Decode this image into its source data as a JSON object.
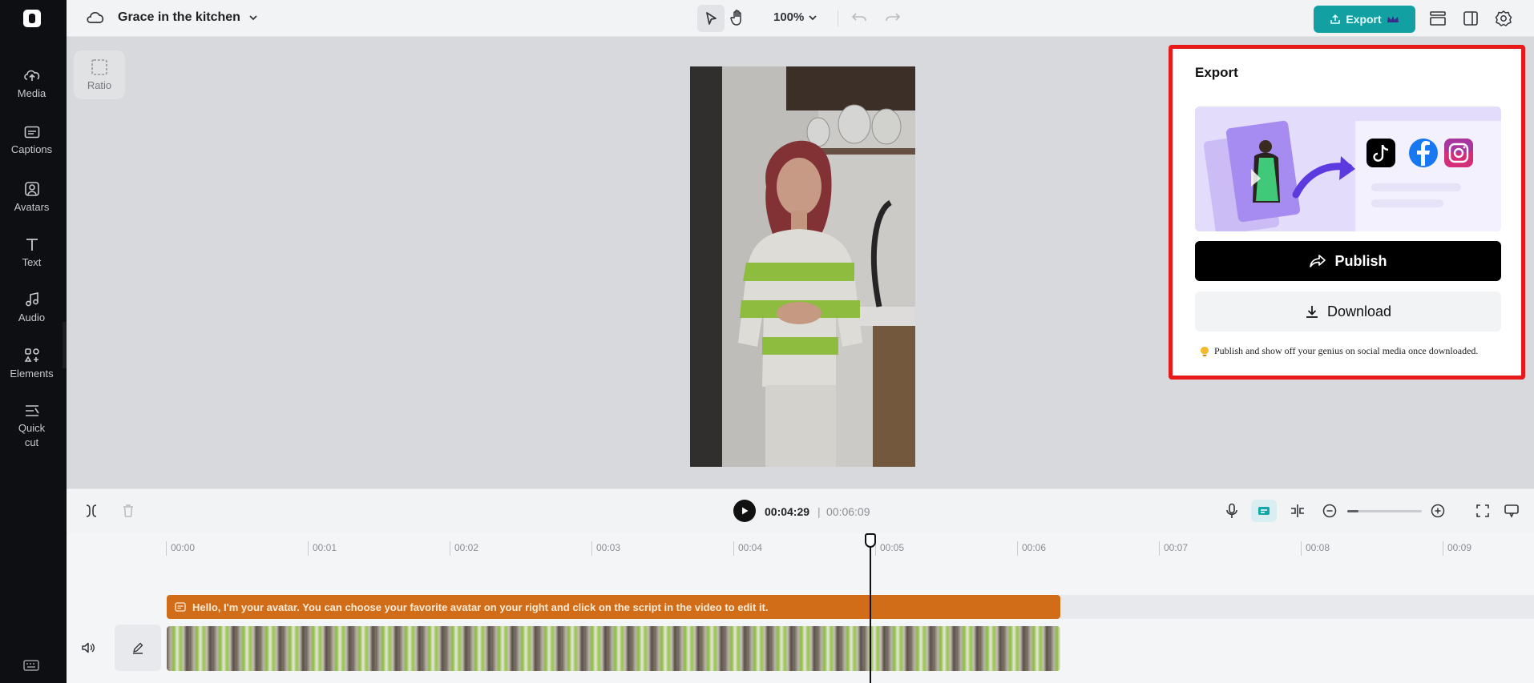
{
  "app": {
    "project_title": "Grace in the kitchen",
    "zoom": "100%",
    "export_label": "Export",
    "accent_color": "#12a0a3"
  },
  "sidebar": {
    "items": [
      {
        "label": "Media",
        "icon": "upload-cloud-icon"
      },
      {
        "label": "Captions",
        "icon": "captions-icon"
      },
      {
        "label": "Avatars",
        "icon": "avatar-icon"
      },
      {
        "label": "Text",
        "icon": "text-icon"
      },
      {
        "label": "Audio",
        "icon": "music-note-icon"
      },
      {
        "label": "Elements",
        "icon": "elements-icon"
      },
      {
        "label": "Quick\ncut",
        "icon": "quick-cut-icon"
      }
    ]
  },
  "canvas": {
    "ratio_label": "Ratio"
  },
  "export_panel": {
    "title": "Export",
    "publish_label": "Publish",
    "download_label": "Download",
    "hint": "Publish and show off your genius on social media once downloaded.",
    "highlight_color": "#e81919"
  },
  "playback": {
    "current_time": "00:04:29",
    "separator": "|",
    "total_time": "00:06:09",
    "zoom_level": 0.15
  },
  "timeline": {
    "ruler": [
      "00:00",
      "00:01",
      "00:02",
      "00:03",
      "00:04",
      "00:05",
      "00:06",
      "00:07",
      "00:08",
      "00:09"
    ],
    "caption_text": "Hello, I'm your avatar. You can choose your favorite avatar on your right and click on the script in the video to edit it.",
    "caption_color": "#d16d19"
  }
}
